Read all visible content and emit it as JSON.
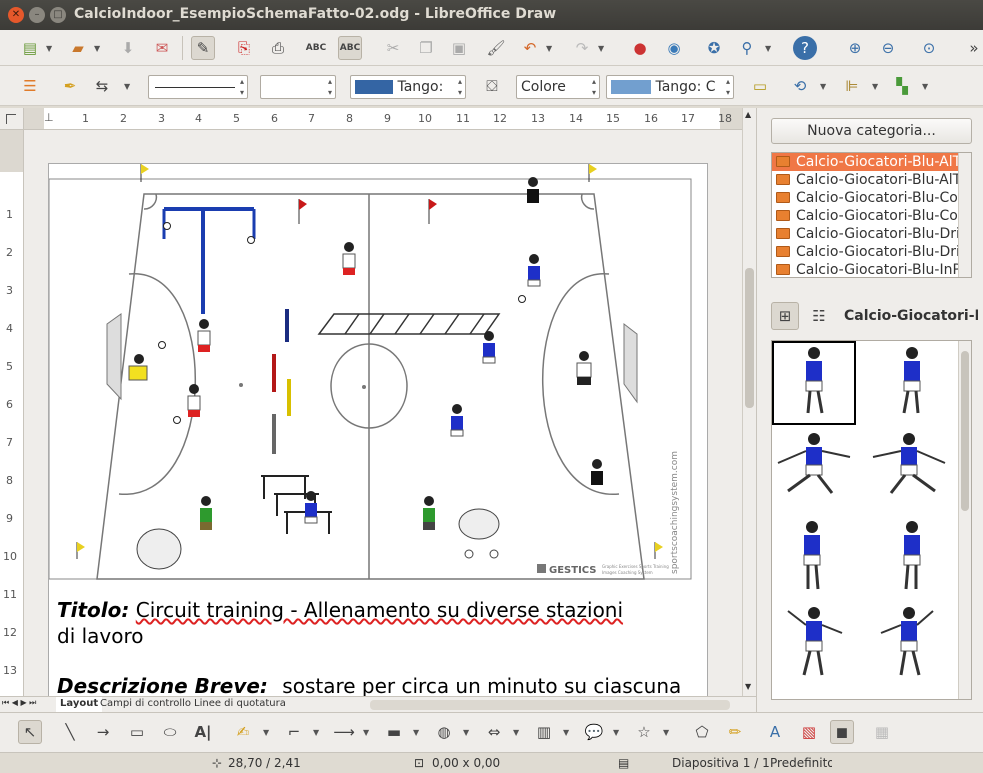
{
  "window": {
    "title": "CalcioIndoor_EsempioSchemaFatto-02.odg - LibreOffice Draw"
  },
  "toolbar2": {
    "line_color_label": "Tango:",
    "area_style": "Colore",
    "area_color_label": "Tango: C",
    "line_color": "#3465a4",
    "area_color": "#729fcf"
  },
  "ruler": {
    "h_ticks": [
      "1",
      "1",
      "2",
      "3",
      "4",
      "5",
      "6",
      "7",
      "8",
      "9",
      "10",
      "11",
      "12",
      "13",
      "14",
      "15",
      "16",
      "17",
      "18"
    ],
    "v_ticks": [
      "1",
      "1",
      "2",
      "3",
      "4",
      "5",
      "6",
      "7",
      "8",
      "9",
      "10",
      "11",
      "12",
      "13"
    ]
  },
  "document": {
    "title_label": "Titolo:",
    "title_text": "Circuit training - Allenamento su diverse stazioni",
    "title_text2": "di lavoro",
    "desc_label": "Descrizione Breve:",
    "desc_text": "sostare per circa un minuto su ciascuna",
    "watermark": "sportscoachingsystem.com",
    "logo": "GESTICS",
    "logo_sub1": "Graphic Exercises Sports Training",
    "logo_sub2": "Images Coaching System"
  },
  "tabs": [
    "Layout",
    "Campi di controllo",
    "Linee di quotatura"
  ],
  "sidebar": {
    "new_category": "Nuova categoria...",
    "categories": [
      "Calcio-Giocatori-Blu-AlTi",
      "Calcio-Giocatori-Blu-AlTi",
      "Calcio-Giocatori-Blu-Corr",
      "Calcio-Giocatori-Blu-Corr",
      "Calcio-Giocatori-Blu-Drib",
      "Calcio-Giocatori-Blu-Drib",
      "Calcio-Giocatori-Blu-InPi"
    ],
    "gallery_title": "Calcio-Giocatori-Bl"
  },
  "status": {
    "position": "28,70 / 2,41",
    "size": "0,00 x 0,00",
    "slide": "Diapositiva 1 / 1",
    "layout": "Predefinito"
  },
  "colors": {
    "accent": "#f07746",
    "title_bg": "#3c3b37"
  }
}
